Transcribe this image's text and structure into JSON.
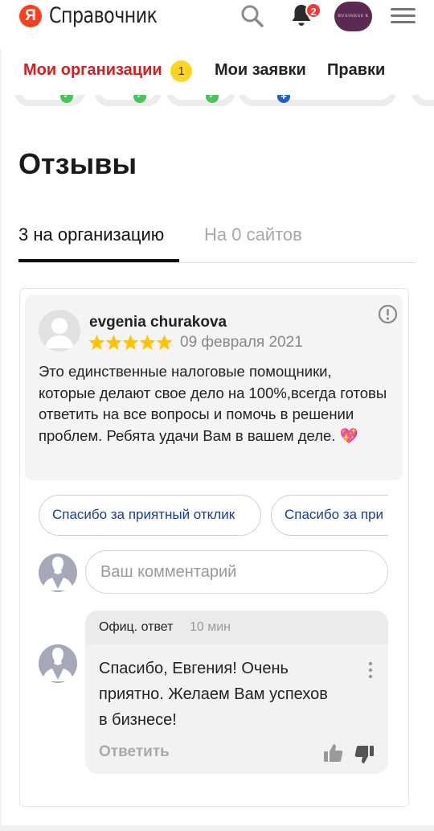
{
  "header": {
    "logo_letter": "Я",
    "app_title": "Справочник",
    "notifications_count": "2",
    "account_avatar_text": "BUSINESS K",
    "icons": [
      "search-icon",
      "bell-icon",
      "menu-icon"
    ]
  },
  "topnav": {
    "items": [
      {
        "label": "Мои организации",
        "count": "1",
        "active": true
      },
      {
        "label": "Мои заявки"
      },
      {
        "label": "Правки"
      }
    ]
  },
  "colors": {
    "brand_red": "#fc3f1d",
    "nav_active": "#d21f1f",
    "count_badge": "#ffd523",
    "star": "#ffc400",
    "link_blue": "#1b3b94"
  },
  "section": {
    "title": "Отзывы",
    "tabs": [
      {
        "label": "3 на организацию",
        "active": true
      },
      {
        "label": "На 0 сайтов",
        "active": false
      }
    ]
  },
  "review": {
    "author": "evgenia churakova",
    "rating": 5,
    "rating_max": 5,
    "date": "09 февраля 2021",
    "text": "Это единственные налоговые помощники, которые делают свое дело на 100%,всегда готовы ответить на все вопросы и помочь в решении проблем. Ребята удачи Вам в вашем деле. 💖"
  },
  "quick_replies": [
    "Спасибо за приятный отклик",
    "Спасибо за при"
  ],
  "comment": {
    "placeholder": "Ваш комментарий"
  },
  "official_reply": {
    "label": "Офиц. ответ",
    "time": "10 мин",
    "text": "Спасибо, Евгения! Очень приятно. Желаем Вам успехов в бизнесе!",
    "answer_label": "Ответить"
  }
}
